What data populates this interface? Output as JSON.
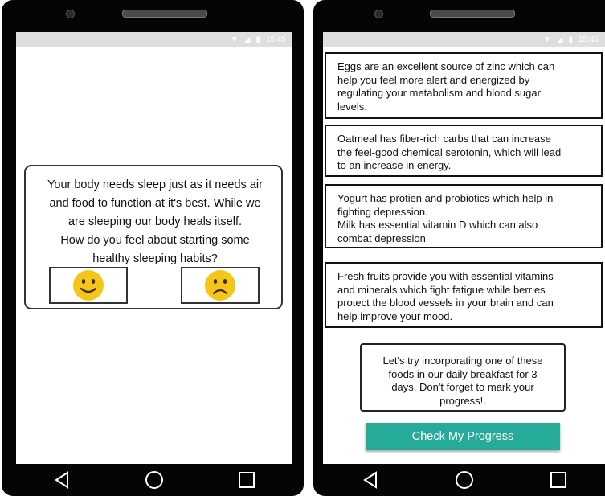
{
  "left_screen": {
    "status_time": "15:45",
    "prompt": {
      "line1": "Your body needs sleep just as it needs air",
      "line2": "and food to function at it's best. While we",
      "line3": "are sleeping our body heals itself.",
      "line4": "How do you feel about starting some",
      "line5": "healthy sleeping habits?"
    },
    "buttons": {
      "happy_icon": "smiling-face-icon",
      "sad_icon": "frowning-face-icon"
    }
  },
  "right_screen": {
    "status_time": "15:45",
    "cards": [
      {
        "lines": [
          "Eggs are an excellent source of zinc which can",
          "help you feel more alert and energized by",
          "regulating your metabolism and blood sugar",
          "levels."
        ]
      },
      {
        "lines": [
          "Oatmeal has fiber-rich carbs that can increase",
          "the feel-good chemical serotonin, which will lead",
          "to an increase in energy."
        ]
      },
      {
        "lines": [
          "Yogurt has protien and probiotics which help in",
          "fighting depression.",
          "Milk has essential vitamin D which can also",
          "combat depression"
        ]
      },
      {
        "lines": [
          "Fresh fruits provide you with essential vitamins",
          "and minerals which fight fatigue while berries",
          "protect the blood vessels in your brain and can",
          "help improve your mood."
        ]
      }
    ],
    "cta": {
      "lines": [
        "Let's try incorporating one of these",
        "foods in our daily breakfast for 3",
        "days. Don't forget to mark your",
        "progress!."
      ]
    },
    "button_label": "Check My Progress"
  },
  "colors": {
    "accent": "#25ab98",
    "emoji": "#f5c518",
    "status_bar": "#dedede"
  },
  "navigation_icons": [
    "back-triangle-icon",
    "home-circle-icon",
    "recents-square-icon"
  ]
}
